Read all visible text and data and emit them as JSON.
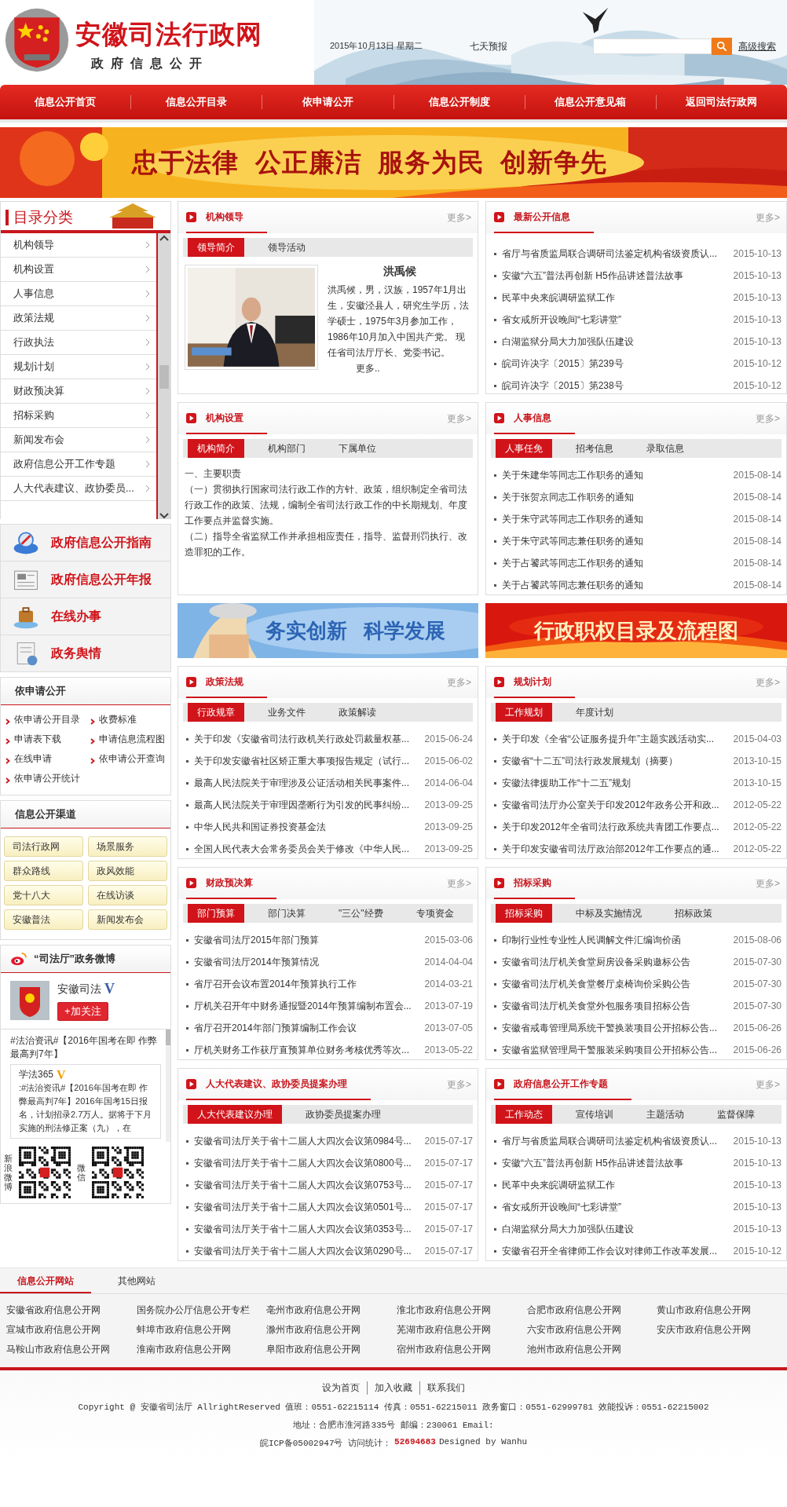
{
  "header": {
    "site_title": "安徽司法行政网",
    "subtitle": "政府信息公开",
    "date": "2015年10月13日  星期二",
    "weather_link": "七天预报",
    "advanced_search": "高级搜索"
  },
  "nav": [
    {
      "label": "信息公开首页"
    },
    {
      "label": "信息公开目录"
    },
    {
      "label": "依申请公开"
    },
    {
      "label": "信息公开制度"
    },
    {
      "label": "信息公开意见箱"
    },
    {
      "label": "返回司法行政网"
    }
  ],
  "banner": {
    "slogan": "忠于法律  公正廉洁  服务为民  创新争先"
  },
  "catalog": {
    "title": "目录分类",
    "items": [
      "机构领导",
      "机构设置",
      "人事信息",
      "政策法规",
      "行政执法",
      "规划计划",
      "财政预决算",
      "招标采购",
      "新闻发布会",
      "政府信息公开工作专题",
      "人大代表建议、政协委员..."
    ]
  },
  "quick_links": [
    {
      "label": "政府信息公开指南",
      "kind": "guide"
    },
    {
      "label": "政府信息公开年报",
      "kind": "report"
    },
    {
      "label": "在线办事",
      "kind": "service"
    },
    {
      "label": "政务舆情",
      "kind": "opinion"
    }
  ],
  "apply_open": {
    "title": "依申请公开",
    "links": [
      "依申请公开目录",
      "收费标准",
      "申请表下载",
      "申请信息流程图",
      "在线申请",
      "依申请公开查询",
      "依申请公开统计"
    ]
  },
  "channels": {
    "title": "信息公开渠道",
    "items": [
      "司法行政网",
      "场景服务",
      "群众路线",
      "政风效能",
      "党十八大",
      "在线访谈",
      "安徽普法",
      "新闻发布会"
    ]
  },
  "weibo": {
    "title": "“司法厅”政务微博",
    "account": "安徽司法",
    "verified_mark": "V",
    "follow_button": "+加关注",
    "intro": "#法治资讯#【2016年国考在即 作弊最高判7年】",
    "post_author": "学法365",
    "post_verified_mark": "V",
    "post_text": ":#法治资讯#【2016年国考在即 作弊最高判7年】2016年国考15日报名，计划招录2.7万人。据将于下月实施的刑法修正案（九），在",
    "qr_labels": [
      "新浪微博",
      "微信"
    ]
  },
  "panels_top": [
    {
      "title": "机构领导",
      "more": "更多>",
      "kind": "profile",
      "tabs": [
        {
          "label": "领导简介",
          "selected": true
        },
        {
          "label": "领导活动",
          "selected": false
        }
      ],
      "name": "洪禹候",
      "bio": "洪禹候，男，汉族，1957年1月出生，安徽泾县人，研究生学历，法学硕士，1975年3月参加工作，1986年10月加入中国共产党。 现任省司法厅厅长、党委书记。",
      "bio_more": "更多.."
    },
    {
      "title": "最新公开信息",
      "more": "更多>",
      "kind": "list",
      "items": [
        {
          "title": "省厅与省质监局联合调研司法鉴定机构省级资质认...",
          "date": "2015-10-13"
        },
        {
          "title": "安徽“六五”普法再创新 H5作品讲述普法故事",
          "date": "2015-10-13"
        },
        {
          "title": "民革中央来皖调研监狱工作",
          "date": "2015-10-13"
        },
        {
          "title": "省女戒所开设晚间“七彩讲堂”",
          "date": "2015-10-13"
        },
        {
          "title": "白湖监狱分局大力加强队伍建设",
          "date": "2015-10-13"
        },
        {
          "title": "皖司许决字〔2015〕第239号",
          "date": "2015-10-12"
        },
        {
          "title": "皖司许决字〔2015〕第238号",
          "date": "2015-10-12"
        }
      ]
    },
    {
      "title": "机构设置",
      "more": "更多>",
      "kind": "text",
      "tabs": [
        {
          "label": "机构简介",
          "selected": true
        },
        {
          "label": "机构部门",
          "selected": false
        },
        {
          "label": "下属单位",
          "selected": false
        }
      ],
      "paragraphs": [
        "一、主要职责",
        "（一）贯彻执行国家司法行政工作的方针、政策，组织制定全省司法行政工作的政策、法规，编制全省司法行政工作的中长期规划、年度工作要点并监督实施。",
        "（二）指导全省监狱工作并承担相应责任，指导、监督刑罚执行、改造罪犯的工作。"
      ]
    },
    {
      "title": "人事信息",
      "more": "更多>",
      "kind": "list",
      "tabs": [
        {
          "label": "人事任免",
          "selected": true
        },
        {
          "label": "招考信息",
          "selected": false
        },
        {
          "label": "录取信息",
          "selected": false
        }
      ],
      "items": [
        {
          "title": "关于朱建华等同志工作职务的通知",
          "date": "2015-08-14"
        },
        {
          "title": "关于张贺京同志工作职务的通知",
          "date": "2015-08-14"
        },
        {
          "title": "关于朱守武等同志工作职务的通知",
          "date": "2015-08-14"
        },
        {
          "title": "关于朱守武等同志兼任职务的通知",
          "date": "2015-08-14"
        },
        {
          "title": "关于占饕武等同志工作职务的通知",
          "date": "2015-08-14"
        },
        {
          "title": "关于占饕武等同志兼任职务的通知",
          "date": "2015-08-14"
        }
      ]
    }
  ],
  "promos": [
    {
      "text": "务实创新   科学发展",
      "kind": "blue"
    },
    {
      "text": "行政职权目录及流程图",
      "kind": "red"
    }
  ],
  "panels_bottom": [
    {
      "title": "政策法规",
      "more": "更多>",
      "kind": "list",
      "tabs": [
        {
          "label": "行政规章",
          "selected": true
        },
        {
          "label": "业务文件",
          "selected": false
        },
        {
          "label": "政策解读",
          "selected": false
        }
      ],
      "items": [
        {
          "title": "关于印发《安徽省司法行政机关行政处罚裁量权基...",
          "date": "2015-06-24"
        },
        {
          "title": "关于印发安徽省社区矫正重大事项报告规定（试行...",
          "date": "2015-06-02"
        },
        {
          "title": "最高人民法院关于审理涉及公证活动相关民事案件...",
          "date": "2014-06-04"
        },
        {
          "title": "最高人民法院关于审理因垄断行为引发的民事纠纷...",
          "date": "2013-09-25"
        },
        {
          "title": "中华人民共和国证券投资基金法",
          "date": "2013-09-25"
        },
        {
          "title": "全国人民代表大会常务委员会关于修改《中华人民...",
          "date": "2013-09-25"
        }
      ]
    },
    {
      "title": "规划计划",
      "more": "更多>",
      "kind": "list",
      "tabs": [
        {
          "label": "工作规划",
          "selected": true
        },
        {
          "label": "年度计划",
          "selected": false
        }
      ],
      "items": [
        {
          "title": "关于印发《全省“公证服务提升年”主题实践活动实...",
          "date": "2015-04-03"
        },
        {
          "title": "安徽省“十二五”司法行政发展规划（摘要）",
          "date": "2013-10-15"
        },
        {
          "title": "安徽法律援助工作“十二五”规划",
          "date": "2013-10-15"
        },
        {
          "title": "安徽省司法厅办公室关于印发2012年政务公开和政...",
          "date": "2012-05-22"
        },
        {
          "title": "关于印发2012年全省司法行政系统共青团工作要点...",
          "date": "2012-05-22"
        },
        {
          "title": "关于印发安徽省司法厅政治部2012年工作要点的通...",
          "date": "2012-05-22"
        }
      ]
    },
    {
      "title": "财政预决算",
      "more": "更多>",
      "kind": "list",
      "tabs": [
        {
          "label": "部门预算",
          "selected": true
        },
        {
          "label": "部门决算",
          "selected": false
        },
        {
          "label": "\"三公\"经费",
          "selected": false
        },
        {
          "label": "专项资金",
          "selected": false
        }
      ],
      "items": [
        {
          "title": "安徽省司法厅2015年部门预算",
          "date": "2015-03-06"
        },
        {
          "title": "安徽省司法厅2014年预算情况",
          "date": "2014-04-04"
        },
        {
          "title": "省厅召开会议布置2014年预算执行工作",
          "date": "2014-03-21"
        },
        {
          "title": "厅机关召开年中财务通报暨2014年预算编制布置会...",
          "date": "2013-07-19"
        },
        {
          "title": "省厅召开2014年部门预算编制工作会议",
          "date": "2013-07-05"
        },
        {
          "title": "厅机关财务工作获厅直预算单位财务考核优秀等次...",
          "date": "2013-05-22"
        }
      ]
    },
    {
      "title": "招标采购",
      "more": "更多>",
      "kind": "list",
      "tabs": [
        {
          "label": "招标采购",
          "selected": true
        },
        {
          "label": "中标及实施情况",
          "selected": false
        },
        {
          "label": "招标政策",
          "selected": false
        }
      ],
      "items": [
        {
          "title": "印制行业性专业性人民调解文件汇编询价函",
          "date": "2015-08-06"
        },
        {
          "title": "安徽省司法厅机关食堂厨房设备采购邀标公告",
          "date": "2015-07-30"
        },
        {
          "title": "安徽省司法厅机关食堂餐厅桌椅询价采购公告",
          "date": "2015-07-30"
        },
        {
          "title": "安徽省司法厅机关食堂外包服务项目招标公告",
          "date": "2015-07-30"
        },
        {
          "title": "安徽省戒毒管理局系统干警换装项目公开招标公告...",
          "date": "2015-06-26"
        },
        {
          "title": "安徽省监狱管理局干警服装采购项目公开招标公告...",
          "date": "2015-06-26"
        }
      ]
    },
    {
      "title": "人大代表建议、政协委员提案办理",
      "more": "更多>",
      "kind": "list",
      "tabs": [
        {
          "label": "人大代表建议办理",
          "selected": true
        },
        {
          "label": "政协委员提案办理",
          "selected": false
        }
      ],
      "items": [
        {
          "title": "安徽省司法厅关于省十二届人大四次会议第0984号...",
          "date": "2015-07-17"
        },
        {
          "title": "安徽省司法厅关于省十二届人大四次会议第0800号...",
          "date": "2015-07-17"
        },
        {
          "title": "安徽省司法厅关于省十二届人大四次会议第0753号...",
          "date": "2015-07-17"
        },
        {
          "title": "安徽省司法厅关于省十二届人大四次会议第0501号...",
          "date": "2015-07-17"
        },
        {
          "title": "安徽省司法厅关于省十二届人大四次会议第0353号...",
          "date": "2015-07-17"
        },
        {
          "title": "安徽省司法厅关于省十二届人大四次会议第0290号...",
          "date": "2015-07-17"
        }
      ]
    },
    {
      "title": "政府信息公开工作专题",
      "more": "更多>",
      "kind": "list",
      "tabs": [
        {
          "label": "工作动态",
          "selected": true
        },
        {
          "label": "宣传培训",
          "selected": false
        },
        {
          "label": "主题活动",
          "selected": false
        },
        {
          "label": "监督保障",
          "selected": false
        }
      ],
      "items": [
        {
          "title": "省厅与省质监局联合调研司法鉴定机构省级资质认...",
          "date": "2015-10-13"
        },
        {
          "title": "安徽“六五”普法再创新 H5作品讲述普法故事",
          "date": "2015-10-13"
        },
        {
          "title": "民革中央来皖调研监狱工作",
          "date": "2015-10-13"
        },
        {
          "title": "省女戒所开设晚间“七彩讲堂”",
          "date": "2015-10-13"
        },
        {
          "title": "白湖监狱分局大力加强队伍建设",
          "date": "2015-10-13"
        },
        {
          "title": "安徽省召开全省律师工作会议对律师工作改革发展...",
          "date": "2015-10-12"
        }
      ]
    }
  ],
  "site_links": {
    "tabs": [
      {
        "label": "信息公开网站",
        "selected": true
      },
      {
        "label": "其他网站",
        "selected": false
      }
    ],
    "links": [
      "安徽省政府信息公开网",
      "国务院办公厅信息公开专栏",
      "亳州市政府信息公开网",
      "淮北市政府信息公开网",
      "合肥市政府信息公开网",
      "黄山市政府信息公开网",
      "宣城市政府信息公开网",
      "蚌埠市政府信息公开网",
      "滁州市政府信息公开网",
      "芜湖市政府信息公开网",
      "六安市政府信息公开网",
      "安庆市政府信息公开网",
      "马鞍山市政府信息公开网",
      "淮南市政府信息公开网",
      "阜阳市政府信息公开网",
      "宿州市政府信息公开网",
      "池州市政府信息公开网"
    ]
  },
  "footer": {
    "links": [
      "设为首页",
      "加入收藏",
      "联系我们"
    ],
    "copyright": "Copyright @ 安徽省司法厅 AllrightReserved 值班：0551-62215114 传真：0551-62215011 政务窗口：0551-62999781 效能投诉：0551-62215002",
    "address": "地址：合肥市淮河路335号 邮编：230061 Email:",
    "icp": "皖ICP备05002947号 访问统计：",
    "visit_count": "52694683",
    "designed": "Designed by Wanhu"
  }
}
